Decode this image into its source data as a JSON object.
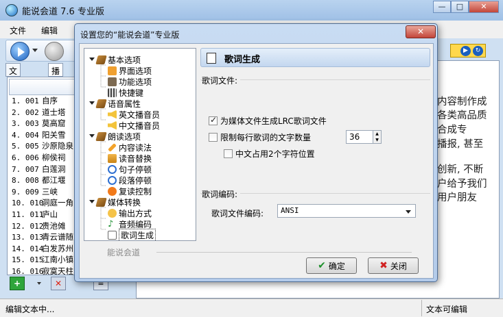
{
  "main": {
    "title": "能说会道 7.6 专业版",
    "window_buttons": [
      "—",
      "□",
      "✕"
    ],
    "menu": [
      "文件",
      "编辑"
    ],
    "tabs": [
      "文件浏览",
      "播放列"
    ],
    "playlist": [
      {
        "idx": "1.  001",
        "name": "自序"
      },
      {
        "idx": "2.  002",
        "name": "道士塔"
      },
      {
        "idx": "3.  003",
        "name": "莫高窟"
      },
      {
        "idx": "4.  004",
        "name": "阳关雪"
      },
      {
        "idx": "5.  005",
        "name": "沙原隐泉"
      },
      {
        "idx": "6.  006",
        "name": "柳侯祠"
      },
      {
        "idx": "7.  007",
        "name": "白莲洞"
      },
      {
        "idx": "8.  008",
        "name": "都江堰"
      },
      {
        "idx": "9.  009",
        "name": "三峡"
      },
      {
        "idx": "10. 010",
        "name": "洞庭一角"
      },
      {
        "idx": "11. 011",
        "name": "庐山"
      },
      {
        "idx": "12. 012",
        "name": "贵池傩"
      },
      {
        "idx": "13. 013",
        "name": "青云谱随"
      },
      {
        "idx": "14. 014",
        "name": "白发苏州"
      },
      {
        "idx": "15. 015",
        "name": "江南小镇"
      },
      {
        "idx": "16. 016",
        "name": "寂寞天柱"
      }
    ],
    "editor_lines": [
      "内容制作成",
      "各类高品质",
      "合成专",
      "播报, 甚至",
      "",
      "创新, 不断",
      "户给予我们",
      "用户朋友"
    ],
    "status_left": "编辑文本中...",
    "status_right": "文本可编辑"
  },
  "dialog": {
    "title": "设置您的“能说会道”专业版",
    "close": "✕",
    "tree": [
      {
        "label": "基本选项",
        "level": 0,
        "icon": "book-icon"
      },
      {
        "label": "界面选项",
        "level": 1,
        "icon": "interface-icon"
      },
      {
        "label": "功能选项",
        "level": 1,
        "icon": "tools-icon"
      },
      {
        "label": "快捷键",
        "level": 1,
        "icon": "keyboard-icon"
      },
      {
        "label": "语音属性",
        "level": 0,
        "icon": "book-icon"
      },
      {
        "label": "英文播音员",
        "level": 1,
        "icon": "speaker-icon"
      },
      {
        "label": "中文播音员",
        "level": 1,
        "icon": "speaker-icon"
      },
      {
        "label": "朗读选项",
        "level": 0,
        "icon": "book-icon"
      },
      {
        "label": "内容读法",
        "level": 1,
        "icon": "pencil-icon"
      },
      {
        "label": "读音替换",
        "level": 1,
        "icon": "replace-icon"
      },
      {
        "label": "句子停顿",
        "level": 1,
        "icon": "clock-icon"
      },
      {
        "label": "段落停顿",
        "level": 1,
        "icon": "clock-icon"
      },
      {
        "label": "复读控制",
        "level": 1,
        "icon": "repeat-icon"
      },
      {
        "label": "媒体转换",
        "level": 0,
        "icon": "book-icon"
      },
      {
        "label": "输出方式",
        "level": 1,
        "icon": "output-icon"
      },
      {
        "label": "音频编码",
        "level": 1,
        "icon": "music-note-icon"
      },
      {
        "label": "歌词生成",
        "level": 1,
        "icon": "lyrics-doc-icon",
        "selected": true
      }
    ],
    "brand": "能说会道",
    "panel_title": "歌词生成",
    "group1_label": "歌词文件:",
    "opt_generate_lrc": "为媒体文件生成LRC歌词文件",
    "opt_generate_lrc_checked": true,
    "opt_limit_chars": "限制每行歌词的文字数量",
    "opt_limit_chars_checked": false,
    "limit_value": "36",
    "opt_cjk_double": "中文占用2个字符位置",
    "opt_cjk_double_checked": false,
    "group2_label": "歌词编码:",
    "encoding_label": "歌词文件编码:",
    "encoding_value": "ANSI",
    "ok_label": "确定",
    "cancel_label": "关闭"
  }
}
